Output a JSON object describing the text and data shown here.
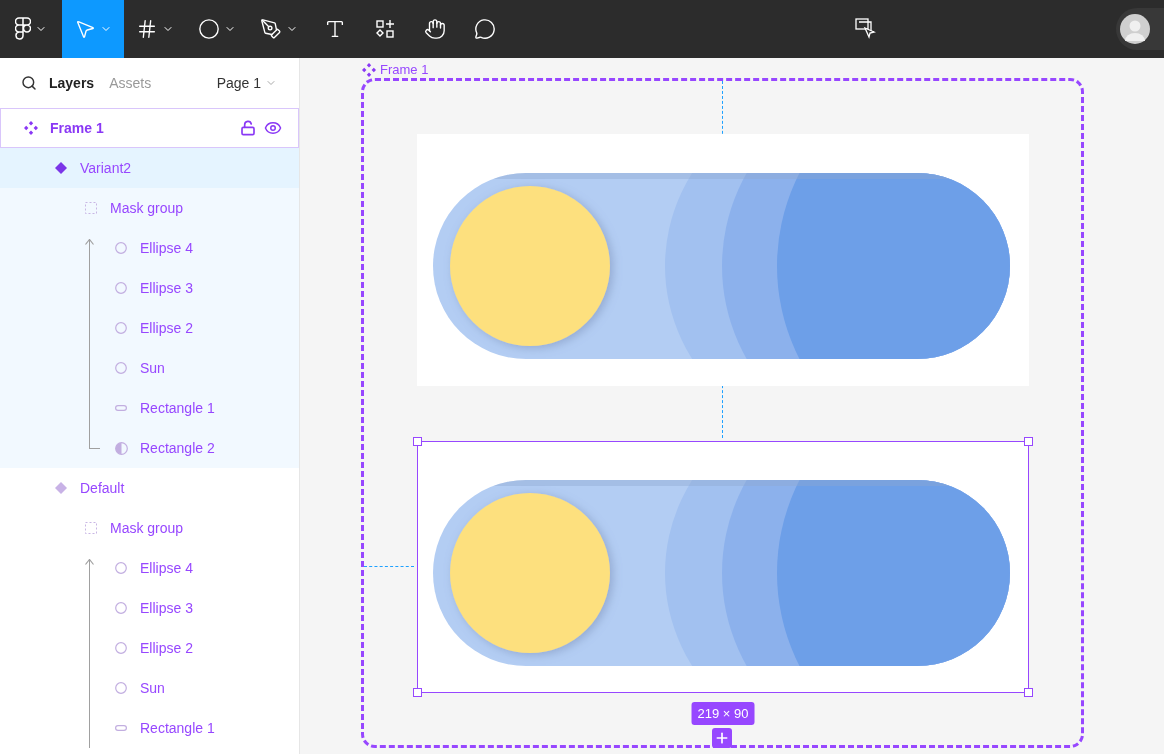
{
  "toolbar": {
    "tools": [
      {
        "kind": "logo",
        "selected": false,
        "menu": true
      },
      {
        "kind": "move",
        "selected": true,
        "menu": true
      },
      {
        "kind": "frame",
        "selected": false,
        "menu": true
      },
      {
        "kind": "ellipse",
        "selected": false,
        "menu": true
      },
      {
        "kind": "pen",
        "selected": false,
        "menu": true
      },
      {
        "kind": "text",
        "selected": false,
        "menu": false
      },
      {
        "kind": "resources",
        "selected": false,
        "menu": false
      },
      {
        "kind": "hand",
        "selected": false,
        "menu": false
      },
      {
        "kind": "comment",
        "selected": false,
        "menu": false
      }
    ]
  },
  "sidebar": {
    "tabs": [
      {
        "label": "Layers",
        "selected": true
      },
      {
        "label": "Assets",
        "selected": false
      }
    ],
    "page": "Page 1",
    "layers": [
      {
        "name": "Frame 1",
        "kind": "component-set",
        "selected": false,
        "hovered": true,
        "children": [
          {
            "name": "Variant2",
            "kind": "variant",
            "selected": true,
            "hovered": false,
            "children": [
              {
                "name": "Mask group",
                "kind": "mask",
                "selected": false,
                "hovered": false,
                "children": [
                  {
                    "name": "Ellipse 4",
                    "kind": "ellipse",
                    "selected": false,
                    "hovered": false
                  },
                  {
                    "name": "Ellipse 3",
                    "kind": "ellipse",
                    "selected": false,
                    "hovered": false
                  },
                  {
                    "name": "Ellipse 2",
                    "kind": "ellipse",
                    "selected": false,
                    "hovered": false
                  },
                  {
                    "name": "Sun",
                    "kind": "ellipse",
                    "selected": false,
                    "hovered": false
                  },
                  {
                    "name": "Rectangle 1",
                    "kind": "rectangle",
                    "selected": false,
                    "hovered": false
                  },
                  {
                    "name": "Rectangle 2",
                    "kind": "mask-shape",
                    "selected": false,
                    "hovered": false
                  }
                ]
              }
            ]
          },
          {
            "name": "Default",
            "kind": "variant",
            "selected": false,
            "hovered": false,
            "children": [
              {
                "name": "Mask group",
                "kind": "mask",
                "selected": false,
                "hovered": false,
                "children": [
                  {
                    "name": "Ellipse 4",
                    "kind": "ellipse",
                    "selected": false,
                    "hovered": false
                  },
                  {
                    "name": "Ellipse 3",
                    "kind": "ellipse",
                    "selected": false,
                    "hovered": false
                  },
                  {
                    "name": "Ellipse 2",
                    "kind": "ellipse",
                    "selected": false,
                    "hovered": false
                  },
                  {
                    "name": "Sun",
                    "kind": "ellipse",
                    "selected": false,
                    "hovered": false
                  },
                  {
                    "name": "Rectangle 1",
                    "kind": "rectangle",
                    "selected": false,
                    "hovered": false
                  }
                ]
              }
            ]
          }
        ]
      }
    ]
  },
  "canvas": {
    "frame_label": "Frame 1",
    "variants": [
      {
        "selected": false
      },
      {
        "selected": true
      }
    ],
    "size_badge": "219 × 90"
  }
}
